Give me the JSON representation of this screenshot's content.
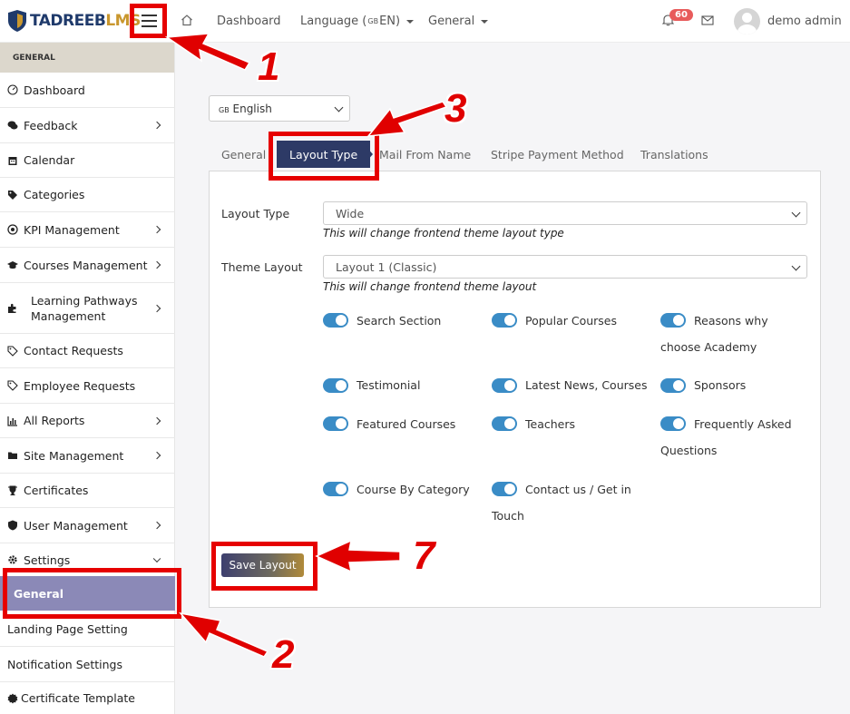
{
  "header": {
    "logo_text_main": "TADREEB",
    "logo_text_accent": "LMS",
    "nav": {
      "dashboard": "Dashboard",
      "language": "Language (",
      "language_flag": "GB",
      "language_code": " EN)",
      "general": "General"
    },
    "notification_count": "60",
    "user_name": "demo admin"
  },
  "sidebar": {
    "section_title": "GENERAL",
    "items": [
      {
        "label": "Dashboard",
        "icon": "gauge-icon"
      },
      {
        "label": "Feedback",
        "icon": "comments-icon"
      },
      {
        "label": "Calendar",
        "icon": "calendar-icon"
      },
      {
        "label": "Categories",
        "icon": "tags-icon"
      },
      {
        "label": "KPI Management",
        "icon": "bullseye-icon"
      },
      {
        "label": "Courses Management",
        "icon": "graduation-cap-icon"
      },
      {
        "label": "Learning Pathways",
        "label2": "Management",
        "icon": "puzzle-icon"
      },
      {
        "label": "Contact Requests",
        "icon": "tag-icon"
      },
      {
        "label": "Employee Requests",
        "icon": "tag-icon"
      },
      {
        "label": "All Reports",
        "icon": "bar-chart-icon"
      },
      {
        "label": "Site Management",
        "icon": "folder-icon"
      },
      {
        "label": "Certificates",
        "icon": "trophy-icon"
      },
      {
        "label": "User Management",
        "icon": "shield-icon"
      },
      {
        "label": "Settings",
        "icon": "gear-icon"
      },
      {
        "label": "General"
      },
      {
        "label": "Landing Page Setting"
      },
      {
        "label": "Notification Settings"
      },
      {
        "label": "Certificate Template",
        "icon": "certificate-icon"
      }
    ]
  },
  "main": {
    "language_select": {
      "flag": "GB",
      "value": " English"
    },
    "tabs": [
      "General",
      "Layout Type",
      "Mail From Name",
      "Stripe Payment Method",
      "Translations"
    ],
    "active_tab": "Layout Type",
    "form": {
      "layout_type_label": "Layout Type",
      "layout_type_value": "Wide",
      "layout_type_help": "This will change frontend theme layout type",
      "theme_layout_label": "Theme Layout",
      "theme_layout_value": "Layout 1 (Classic)",
      "theme_layout_help": "This will change frontend theme layout"
    },
    "toggles": [
      {
        "label": "Search Section",
        "on": true
      },
      {
        "label": "Popular Courses",
        "on": true
      },
      {
        "label": "Reasons why choose Academy",
        "on": true
      },
      {
        "label": "Testimonial",
        "on": true
      },
      {
        "label": "Latest News, Courses",
        "on": true
      },
      {
        "label": "Sponsors",
        "on": true
      },
      {
        "label": "Featured Courses",
        "on": true
      },
      {
        "label": "Teachers",
        "on": true
      },
      {
        "label": "Frequently Asked Questions",
        "on": true
      },
      {
        "label": "Course By Category",
        "on": true
      },
      {
        "label": "Contact us / Get in Touch",
        "on": true
      }
    ],
    "save_label": "Save Layout"
  },
  "annotations": {
    "n1": "1",
    "n2": "2",
    "n3": "3",
    "n7": "7"
  },
  "colors": {
    "accent_navy": "#2d3a66",
    "toggle_blue": "#3a8cc6",
    "active_sidebar": "#8b89b7",
    "annotation_red": "#e60000"
  }
}
